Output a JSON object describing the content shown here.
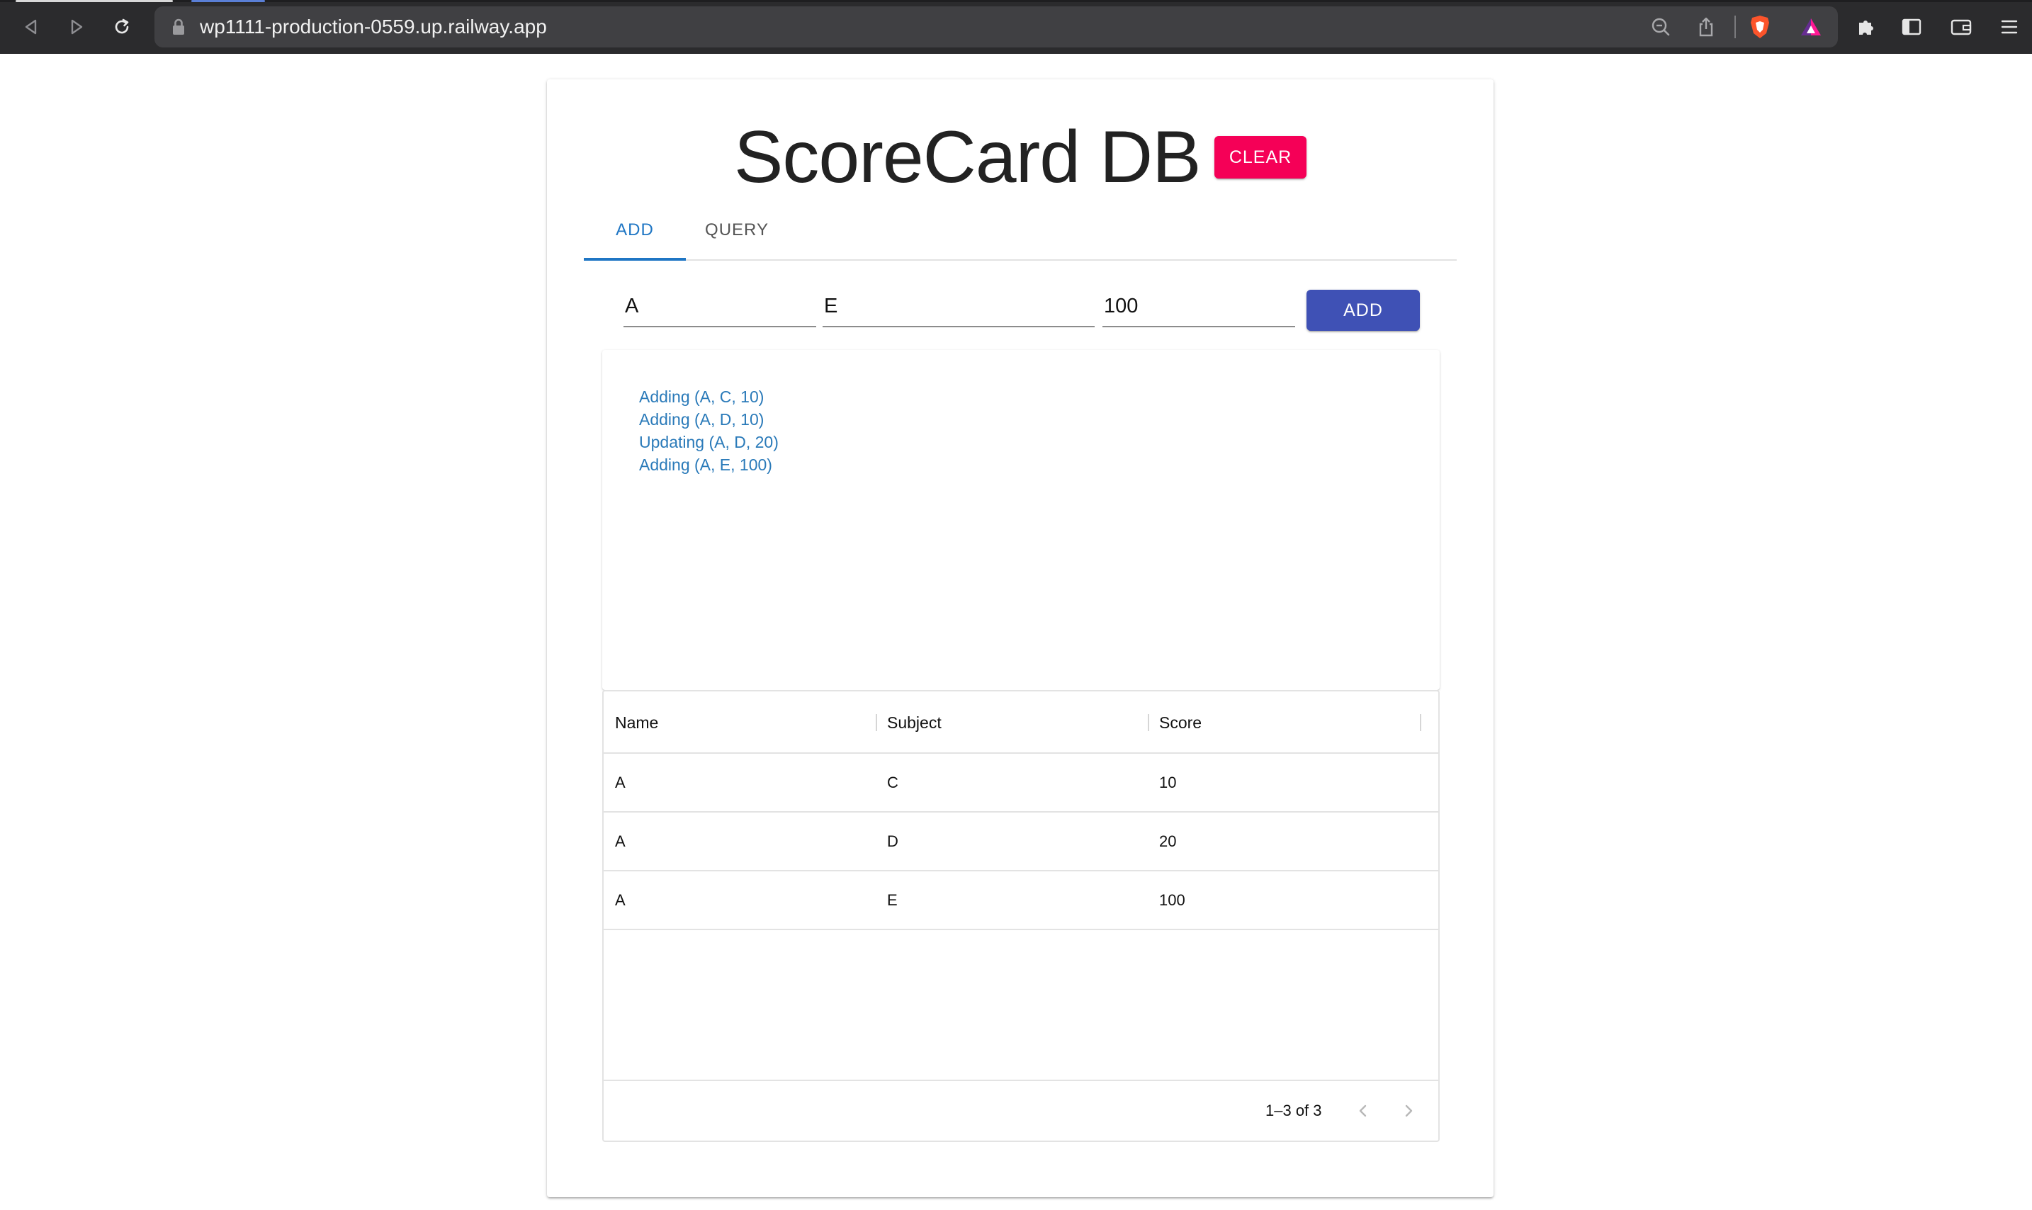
{
  "browser": {
    "url": "wp1111-production-0559.up.railway.app",
    "icons": [
      "back-icon",
      "forward-icon",
      "reload-icon",
      "lock-icon",
      "zoom-out-icon",
      "share-icon",
      "brave-shield-icon",
      "brave-rewards-icon",
      "extensions-icon",
      "sidebar-icon",
      "wallet-icon",
      "menu-icon"
    ]
  },
  "header": {
    "title": "ScoreCard DB",
    "clear_label": "CLEAR",
    "clear_color": "#f50057"
  },
  "tabs": [
    {
      "label": "ADD",
      "active": true
    },
    {
      "label": "QUERY",
      "active": false
    }
  ],
  "form": {
    "name_value": "A",
    "subject_value": "E",
    "score_value": "100",
    "add_label": "ADD",
    "add_color": "#3f51b5"
  },
  "log": {
    "messages": [
      "Adding (A, C, 10)",
      "Adding (A, D, 10)",
      "Updating (A, D, 20)",
      "Adding (A, E, 100)"
    ],
    "color": "#2a7ab9"
  },
  "table": {
    "columns": [
      "Name",
      "Subject",
      "Score"
    ],
    "rows": [
      [
        "A",
        "C",
        "10"
      ],
      [
        "A",
        "D",
        "20"
      ],
      [
        "A",
        "E",
        "100"
      ]
    ],
    "pagination": "1–3 of 3"
  }
}
